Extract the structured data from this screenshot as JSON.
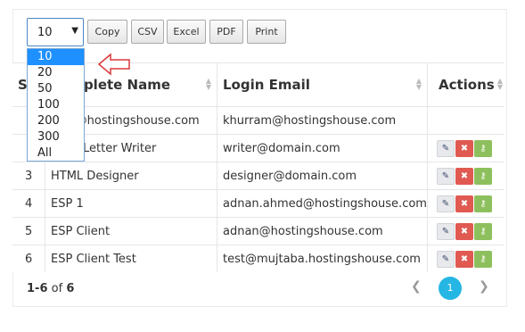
{
  "length_menu": {
    "selected": "10",
    "options": [
      "10",
      "20",
      "50",
      "100",
      "200",
      "300",
      "All"
    ]
  },
  "toolbar": {
    "copy_label": "Copy",
    "csv_label": "CSV",
    "excel_label": "Excel",
    "pdf_label": "PDF",
    "print_label": "Print"
  },
  "table": {
    "columns": [
      "Sr",
      "Complete Name",
      "Login Email",
      "Actions"
    ],
    "rows": [
      {
        "sr": "",
        "name": "",
        "email": "khurram@hostingshouse.com"
      },
      {
        "sr": "",
        "name": "Letter Writer",
        "email": "writer@domain.com"
      },
      {
        "sr": "3",
        "name": "HTML Designer",
        "email": "designer@domain.com"
      },
      {
        "sr": "4",
        "name": "ESP 1",
        "email": "adnan.ahmed@hostingshouse.com"
      },
      {
        "sr": "5",
        "name": "ESP Client",
        "email": "adnan@hostingshouse.com"
      },
      {
        "sr": "6",
        "name": "ESP Client Test",
        "email": "test@mujtaba.hostingshouse.com"
      }
    ],
    "partial_row1_name": "m@hostingshouse.com"
  },
  "footer": {
    "range": "1-6",
    "of_label": "of",
    "total": "6",
    "current_page": "1"
  }
}
